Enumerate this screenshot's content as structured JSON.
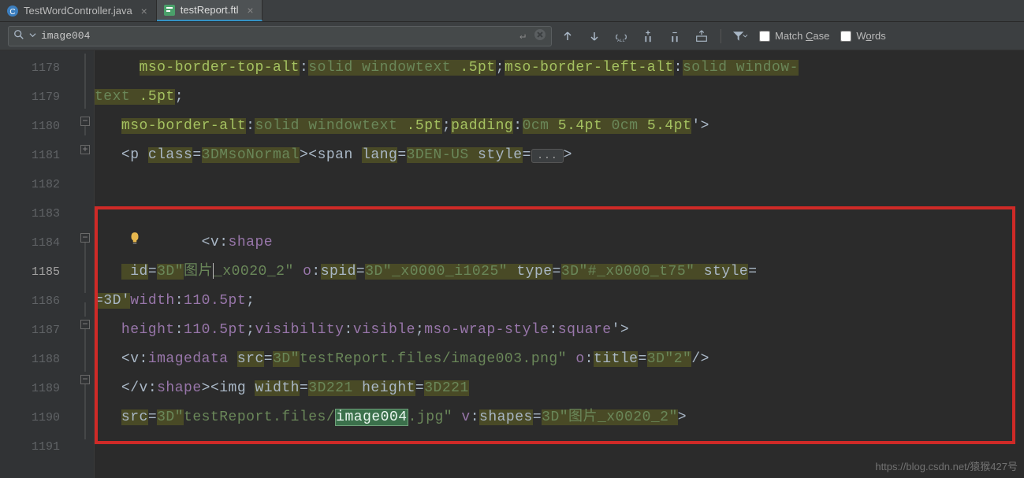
{
  "tabs": [
    {
      "label": "TestWordController.java",
      "icon": "java"
    },
    {
      "label": "testReport.ftl",
      "icon": "ftl"
    }
  ],
  "find": {
    "value": "image004",
    "match_case": "Match Case",
    "words": "Words"
  },
  "gutter": [
    "1178",
    "1179",
    "1180",
    "1181",
    "1182",
    "1183",
    "1184",
    "1185",
    "1186",
    "1187",
    "1188",
    "1189",
    "1190",
    "1191"
  ],
  "code": {
    "l0": {
      "a": "mso-border-top-alt",
      "b": ":",
      "c": "solid ",
      "d": "windowtext ",
      "e": ".5pt",
      "f": ";",
      "g": "mso-border-left-alt",
      "h": ":",
      "i": "solid ",
      "j": "window-"
    },
    "l1": {
      "a": "text ",
      "b": ".5pt",
      "c": ";"
    },
    "l2": {
      "a": "mso-border-alt",
      "b": ":",
      "c": "solid ",
      "d": "windowtext ",
      "e": ".5pt",
      "f": ";",
      "g": "padding",
      "h": ":",
      "i": "0cm ",
      "j": "5.4pt ",
      "k": "0cm ",
      "l": "5.4pt",
      "m": "'>"
    },
    "l3": {
      "a": "<p ",
      "b": "class",
      "c": "=",
      "d": "3DMsoNormal",
      "e": ">",
      "f": "<span ",
      "g": "lang",
      "h": "=",
      "i": "3DEN-US ",
      "j": "style",
      "k": "=",
      "l": "...",
      "m": ">"
    },
    "l4": {
      "a": ""
    },
    "l5": {
      "a": ""
    },
    "l6": {
      "a": "<v",
      "b": ":",
      "c": "shape"
    },
    "l7": {
      "a": " id",
      "b": "=",
      "c": "3D\"",
      "d": "图片",
      "e": "_x0020_2\" ",
      "f": "o",
      "g": ":",
      "h": "spid",
      "i": "=",
      "j": "3D\"_x0000_i1025\" ",
      "k": "type",
      "l": "=",
      "m": "3D\"#_x0000_t75\" ",
      "n": "style",
      "o": "="
    },
    "l8": {
      "a": "=3D'",
      "b": "width",
      "c": ":",
      "d": "110.5pt",
      "e": ";"
    },
    "l9": {
      "a": "height",
      "b": ":",
      "c": "110.5pt",
      "d": ";",
      "e": "visibility",
      "f": ":",
      "g": "visible",
      "h": ";",
      "i": "mso-wrap-style",
      "j": ":",
      "k": "square",
      "l": "'>"
    },
    "l10": {
      "a": "<v",
      "b": ":",
      "c": "imagedata ",
      "d": "src",
      "e": "=",
      "f": "3D\"",
      "g": "testReport.files/image003.png\" ",
      "h": "o",
      "i": ":",
      "j": "title",
      "k": "=",
      "l": "3D\"2\"",
      "m": "/>"
    },
    "l11": {
      "a": "</v",
      "b": ":",
      "c": "shape",
      "d": ">",
      "e": "<img ",
      "f": "width",
      "g": "=",
      "h": "3D221 ",
      "i": "height",
      "j": "=",
      "k": "3D221"
    },
    "l12": {
      "a": "src",
      "b": "=",
      "c": "3D\"",
      "d": "testReport.files/",
      "e": "image004",
      "f": ".jpg\" ",
      "g": "v",
      "h": ":",
      "i": "shapes",
      "j": "=",
      "k": "3D\"图片_x0020_2\"",
      "l": ">"
    },
    "l13": {
      "a": ""
    }
  },
  "watermark": "https://blog.csdn.net/猿猴427号"
}
